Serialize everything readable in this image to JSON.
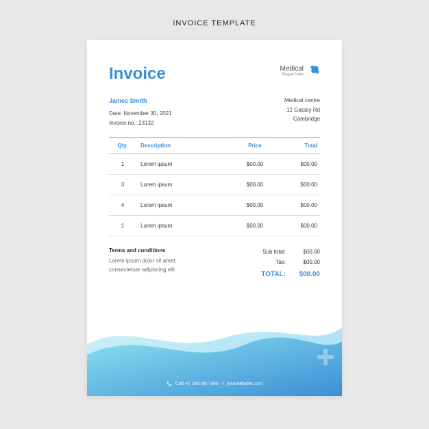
{
  "page_label": "INVOICE TEMPLATE",
  "header": {
    "title": "Invoice",
    "brand_name": "Medical",
    "brand_slogan": "Slogan here"
  },
  "customer": {
    "name": "James Smith",
    "date_label": "Date:",
    "date": "November 30, 2021",
    "invoice_no_label": "Invoice no.:",
    "invoice_no": "23132"
  },
  "company": {
    "name": "Medical centre",
    "street": "12 Gatsby Rd",
    "city": "Cambridge"
  },
  "columns": {
    "qty": "Qty.",
    "description": "Description",
    "price": "Price",
    "total": "Total"
  },
  "rows": [
    {
      "qty": "1",
      "desc": "Lorem ipsum",
      "price": "$00.00",
      "total": "$00.00"
    },
    {
      "qty": "3",
      "desc": "Lorem ipsum",
      "price": "$00.00",
      "total": "$00.00"
    },
    {
      "qty": "4",
      "desc": "Lorem ipsum",
      "price": "$00.00",
      "total": "$00.00"
    },
    {
      "qty": "1",
      "desc": "Lorem ipsum",
      "price": "$00.00",
      "total": "$00.00"
    }
  ],
  "terms": {
    "title": "Terms and conditions",
    "text": "Lorem ipsum dolor sit amet, consectetuer adipiscing elit"
  },
  "summary": {
    "subtotal_label": "Sub total:",
    "subtotal": "$00.00",
    "tax_label": "Tax:",
    "tax": "$00.00",
    "total_label": "TOTAL:",
    "total": "$00.00"
  },
  "footer": {
    "phone": "Call +1 234 567 890",
    "sep": "/",
    "website": "yourwebsite.com"
  },
  "colors": {
    "accent": "#3b8fd6",
    "wave_top": "#6dd5ed",
    "wave_bottom": "#2193b0"
  }
}
